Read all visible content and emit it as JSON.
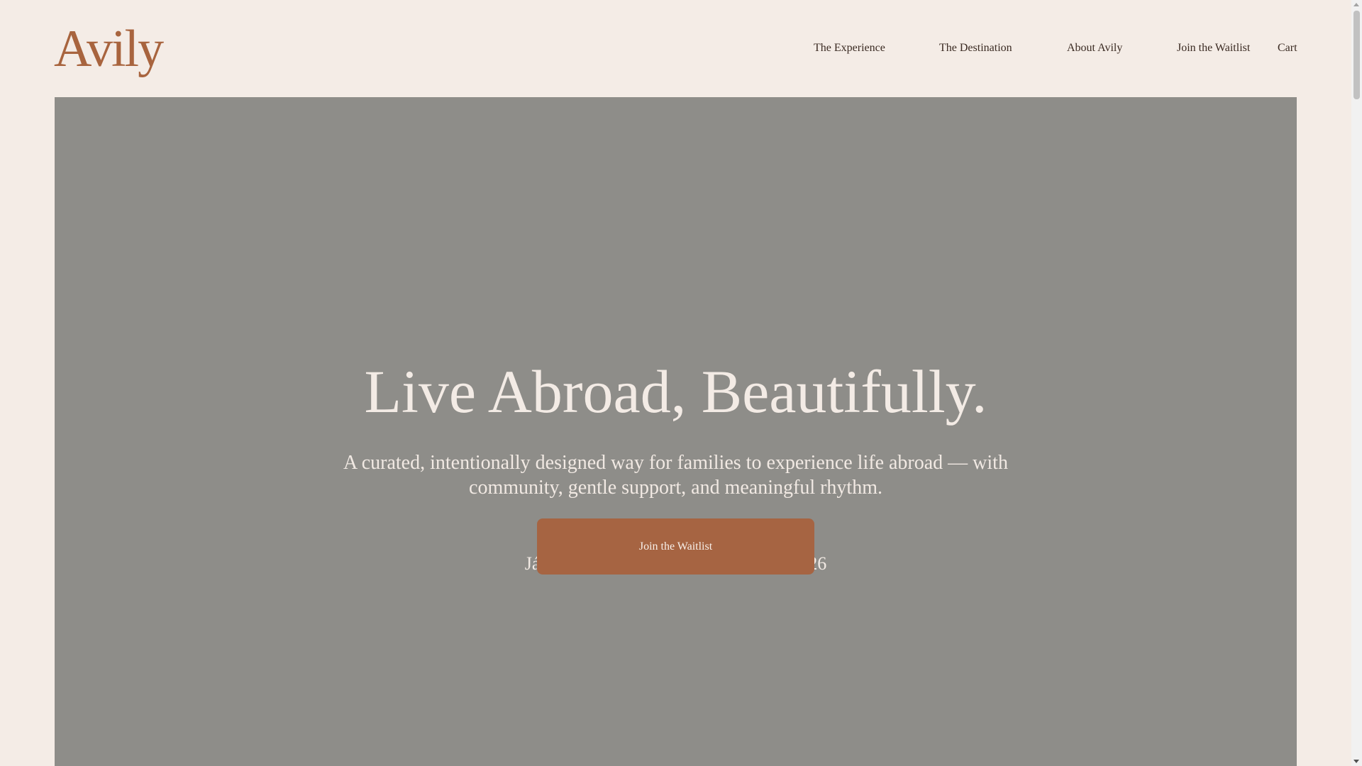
{
  "brand": {
    "logo_text": "Avily",
    "accent_color": "#A8643E"
  },
  "nav": {
    "items": [
      {
        "label": "The Experience"
      },
      {
        "label": "The Destination"
      },
      {
        "label": "About Avily"
      },
      {
        "label": "Join the Waitlist"
      },
      {
        "label": "Cart"
      }
    ]
  },
  "hero": {
    "title": "Live Abroad, Beautifully.",
    "subtitle": "A curated, intentionally designed way for families to experience life abroad — with community, gentle support, and meaningful rhythm.",
    "meta": "Jávea, Spain | June 28 — August 1, 2026",
    "cta_label": "Join the Waitlist",
    "cta_color": "#A66442",
    "background_color": "#8E8D89"
  },
  "colors": {
    "page_background": "#F4ECE6",
    "nav_text": "#3A2A22",
    "hero_text": "#F3EBE5"
  }
}
